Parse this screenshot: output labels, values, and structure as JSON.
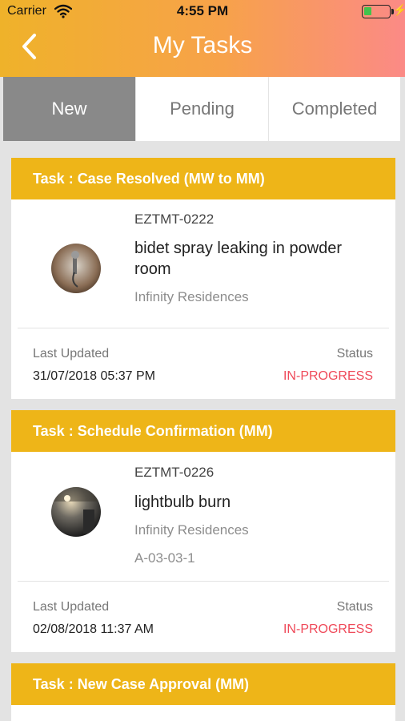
{
  "status_bar": {
    "carrier": "Carrier",
    "time": "4:55 PM"
  },
  "nav": {
    "title": "My Tasks",
    "back_icon": "chevron-left-icon"
  },
  "tabs": [
    {
      "label": "New",
      "active": true
    },
    {
      "label": "Pending",
      "active": false
    },
    {
      "label": "Completed",
      "active": false
    }
  ],
  "tasks": [
    {
      "header": "Task : Case Resolved (MW to MM)",
      "code": "EZTMT-0222",
      "description": "bidet spray leaking in powder room",
      "location": "Infinity Residences",
      "last_updated_label": "Last Updated",
      "last_updated": "31/07/2018 05:37 PM",
      "status_label": "Status",
      "status": "IN-PROGRESS"
    },
    {
      "header": "Task : Schedule Confirmation (MM)",
      "code": "EZTMT-0226",
      "description": "lightbulb burn",
      "location": "Infinity Residences",
      "unit": "A-03-03-1",
      "last_updated_label": "Last Updated",
      "last_updated": "02/08/2018 11:37 AM",
      "status_label": "Status",
      "status": "IN-PROGRESS"
    },
    {
      "header": "Task : New Case Approval (MM)"
    }
  ],
  "colors": {
    "header_gradient_start": "#efb22a",
    "header_gradient_end": "#fb8a86",
    "card_header": "#eeb518",
    "status": "#ef4a5a",
    "tab_active": "#898989"
  }
}
